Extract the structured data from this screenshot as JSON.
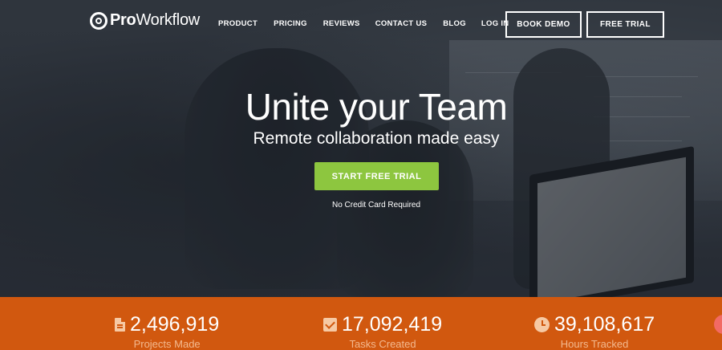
{
  "brand": {
    "name_bold": "Pro",
    "name_regular": "Workflow"
  },
  "nav": {
    "links": [
      "PRODUCT",
      "PRICING",
      "REVIEWS",
      "CONTACT US",
      "BLOG",
      "LOG IN"
    ],
    "book_demo": "BOOK DEMO",
    "free_trial": "FREE TRIAL"
  },
  "hero": {
    "headline": "Unite your Team",
    "subheadline": "Remote collaboration made easy",
    "cta": "START FREE TRIAL",
    "note": "No Credit Card Required"
  },
  "stats": [
    {
      "icon": "document-icon",
      "value": "2,496,919",
      "label": "Projects Made"
    },
    {
      "icon": "checkbox-icon",
      "value": "17,092,419",
      "label": "Tasks Created"
    },
    {
      "icon": "clock-icon",
      "value": "39,108,617",
      "label": "Hours Tracked"
    }
  ],
  "colors": {
    "accent_green": "#8dc63f",
    "stats_orange": "#d1580f"
  }
}
